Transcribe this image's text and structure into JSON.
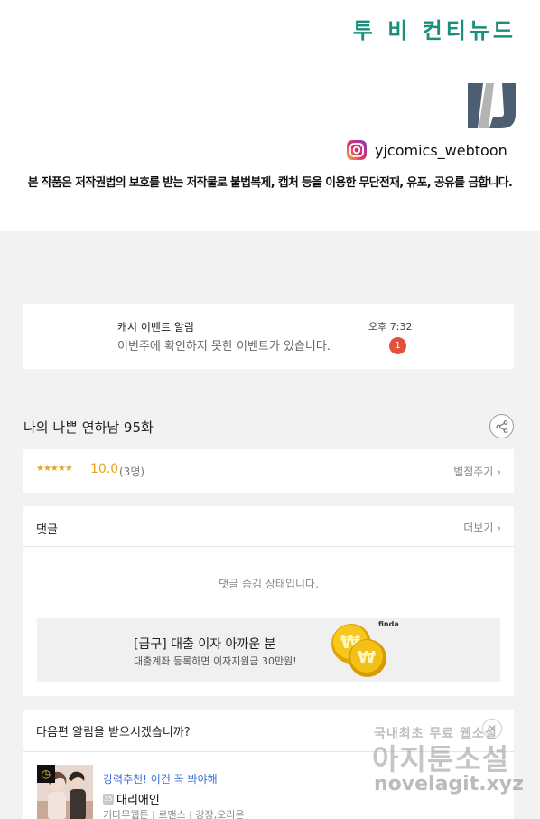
{
  "header": {
    "continue_text": "투 비 컨티뉴드",
    "instagram_handle": "yjcomics_webtoon",
    "copyright_notice": "본 작품은 저작권법의 보호를 받는 저작물로 불법복제, 캡처 등을 이용한 무단전재, 유포, 공유를 금합니다.",
    "logo_icon": "yj-logo",
    "instagram_icon": "instagram-icon"
  },
  "alarm": {
    "title": "캐시 이벤트 알림",
    "body": "이번주에 확인하지 못한 이벤트가 있습니다.",
    "time": "오후 7:32",
    "badge": "1"
  },
  "episode": {
    "title": "나의 나쁜 연하남 95화",
    "share_icon": "share-icon"
  },
  "rating": {
    "stars": "★★★★★",
    "score": "10.0",
    "voters": "(3명)",
    "rate_link": "별점주기"
  },
  "comments": {
    "title": "댓글",
    "more_link": "더보기",
    "hidden_text": "댓글 숨김 상태입니다."
  },
  "ad": {
    "title": "[급구] 대출 이자 아까운 분",
    "subtitle": "대출계좌 등록하면 이자지원금 30만원!",
    "brand": "finda"
  },
  "next_alarm": {
    "title": "다음편 알림을 받으시겠습니까?",
    "recommend_head": "강력추천! 이건 꼭 봐야해",
    "age_badge": "15",
    "rec_title": "대리애인",
    "rec_meta": "기다무웹툰 | 로맨스 | 강장,오리온"
  },
  "watermark": {
    "line1": "국내최초 무료 웹소설",
    "line2": "아지툰소설",
    "line3": "novelagit.xyz"
  },
  "colors": {
    "accent_green": "#1a8f7a",
    "star": "#e8a31a",
    "badge_red": "#e4513b",
    "link_blue": "#3b6fd6"
  }
}
